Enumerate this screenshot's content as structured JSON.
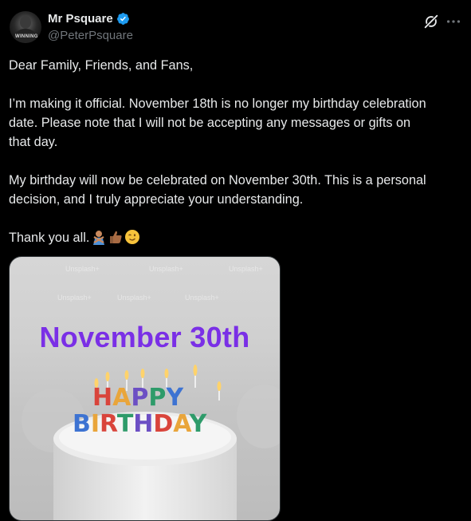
{
  "author": {
    "name": "Mr Psquare",
    "handle": "@PeterPsquare",
    "avatar_text": "WINNING"
  },
  "tweet": {
    "paragraphs": [
      "Dear Family, Friends, and Fans,",
      "I’m making it official. November 18th is no longer my birthday celebration\ndate. Please note that I will not be accepting any messages or gifts on\nthat day.",
      "My birthday will now be celebrated on November 30th. This is a personal\ndecision, and I truly appreciate your understanding.",
      "Thank you all."
    ],
    "emojis": [
      "person-gesturing-no-emoji",
      "thumbs-up-medium-dark-emoji",
      "winking-face-emoji"
    ]
  },
  "media": {
    "date_text": "November 30th",
    "candle_row1": "HAPPY",
    "candle_row2": "BIRTHDAY",
    "watermark": "Unsplash+"
  },
  "colors": {
    "background": "#000000",
    "text": "#e7e9ea",
    "secondary": "#71767b",
    "verified": "#1d9bf0",
    "date_text": "#7a2fe6"
  }
}
